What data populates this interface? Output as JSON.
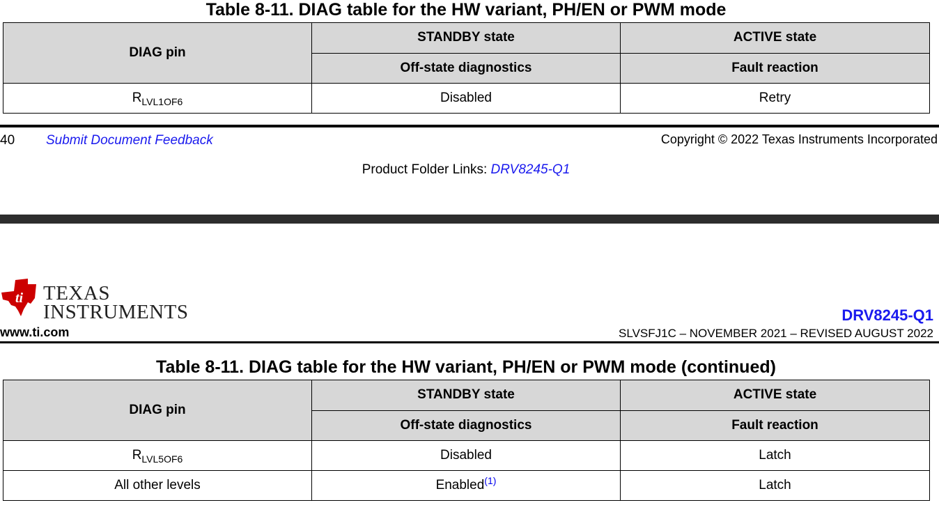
{
  "table_top": {
    "title": "Table 8-11. DIAG table for the HW variant, PH/EN or PWM mode",
    "headers": {
      "diag_pin": "DIAG pin",
      "standby": "STANDBY state",
      "active": "ACTIVE state",
      "offstate": "Off-state diagnostics",
      "fault": "Fault reaction"
    },
    "rows": [
      {
        "pin_main": "R",
        "pin_sub": "LVL1OF6",
        "standby": "Disabled",
        "active": "Retry"
      }
    ]
  },
  "footer": {
    "page_number": "40",
    "feedback_link": "Submit Document Feedback",
    "copyright": "Copyright © 2022 Texas Instruments Incorporated",
    "folder_label": "Product Folder Links: ",
    "folder_link": "DRV8245-Q1"
  },
  "header": {
    "logo_line1": "TEXAS",
    "logo_line2": "INSTRUMENTS",
    "website": "www.ti.com",
    "product": "DRV8245-Q1",
    "doc_id": "SLVSFJ1C – NOVEMBER 2021 – REVISED AUGUST 2022"
  },
  "table_bottom": {
    "title": "Table 8-11. DIAG table for the HW variant, PH/EN or PWM mode (continued)",
    "headers": {
      "diag_pin": "DIAG pin",
      "standby": "STANDBY state",
      "active": "ACTIVE state",
      "offstate": "Off-state diagnostics",
      "fault": "Fault reaction"
    },
    "rows": [
      {
        "pin_main": "R",
        "pin_sub": "LVL5OF6",
        "standby": "Disabled",
        "active": "Latch"
      },
      {
        "pin_main": "All other levels",
        "standby": "Enabled",
        "footnote": "(1)",
        "active": "Latch"
      }
    ]
  },
  "colors": {
    "link": "#1a1aee",
    "header_bg": "#d7d7d7",
    "ti_red": "#cc0000"
  },
  "icons": [
    "ti-logo-icon"
  ]
}
